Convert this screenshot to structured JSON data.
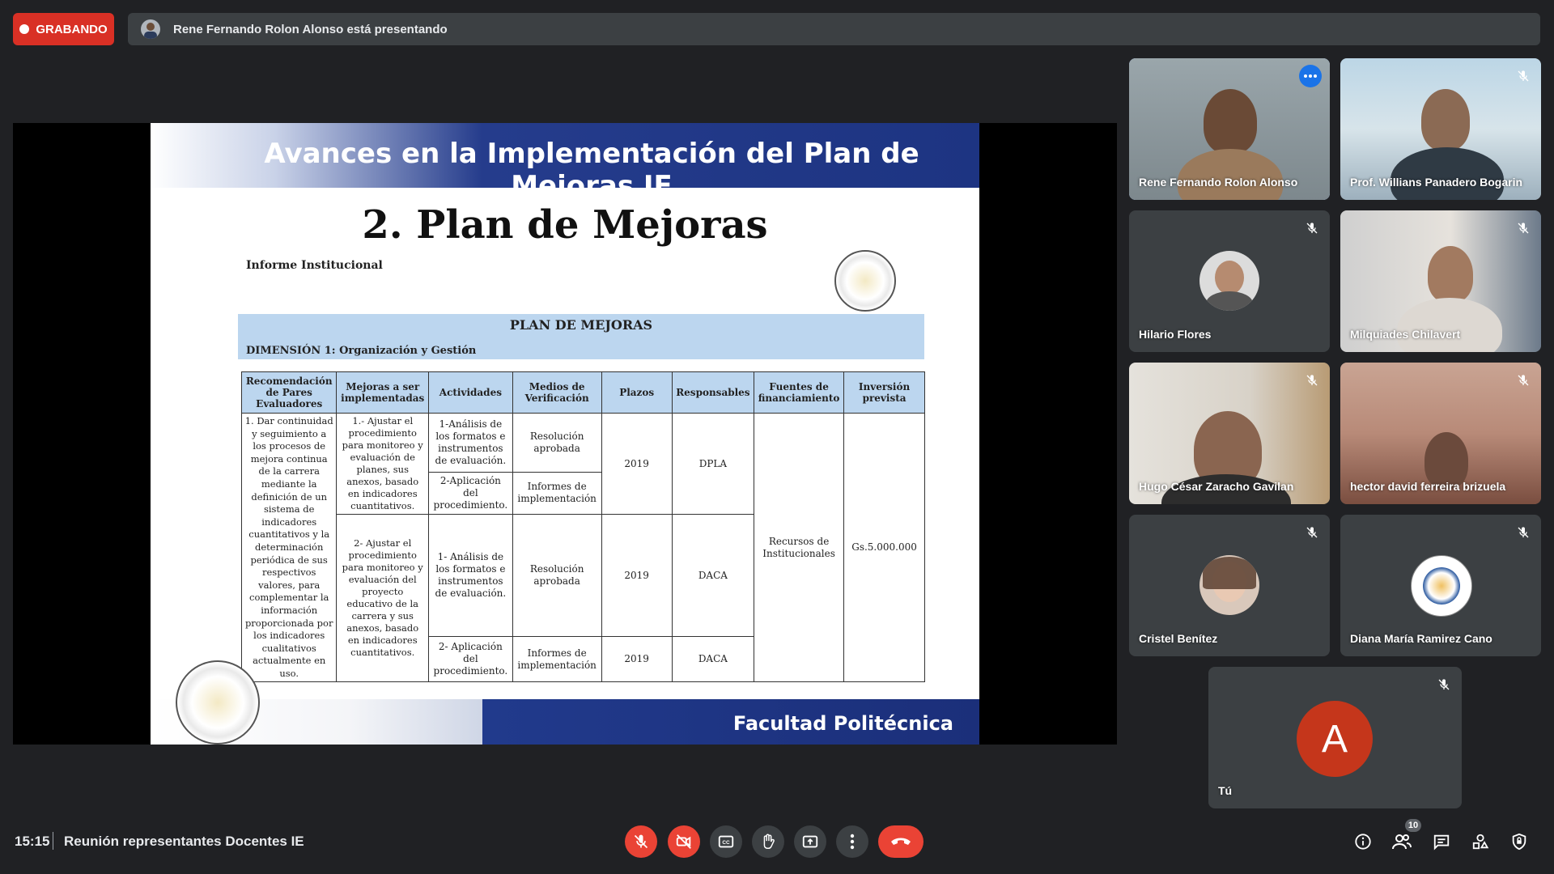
{
  "recording": {
    "label": "GRABANDO"
  },
  "presenting": {
    "text": "Rene Fernando Rolon Alonso está presentando"
  },
  "slide": {
    "header_title": "Avances en la Implementación del Plan de Mejoras IE",
    "subtitle": "2. Plan de Mejoras",
    "report_label": "Informe Institucional",
    "plan_title": "PLAN DE MEJORAS",
    "dimension": "DIMENSIÓN 1: Organización y Gestión",
    "footer": "Facultad Politécnica",
    "table": {
      "headers": [
        "Recomendación de Pares Evaluadores",
        "Mejoras a ser implementadas",
        "Actividades",
        "Medios de Verificación",
        "Plazos",
        "Responsables",
        "Fuentes de financiamiento",
        "Inversión prevista"
      ],
      "recommendation": "1. Dar continuidad y seguimiento a los procesos de mejora continua de la carrera mediante la definición de un sistema de indicadores cuantitativos y la determinación periódica de sus respectivos valores, para complementar la información proporcionada por los indicadores cualitativos actualmente en uso.",
      "improvement_1": "1.- Ajustar el procedimiento para monitoreo y evaluación de planes, sus anexos, basado en indicadores cuantitativos.",
      "improvement_2": "2- Ajustar el procedimiento para monitoreo y evaluación del proyecto educativo de la carrera y sus anexos, basado en indicadores cuantitativos.",
      "act_1": "1-Análisis de los formatos e instrumentos de evaluación.",
      "act_2": "2-Aplicación del procedimiento.",
      "act_3": "1- Análisis de los formatos e instrumentos de evaluación.",
      "act_4": "2- Aplicación del procedimiento.",
      "verif_1": "Resolución aprobada",
      "verif_2": "Informes de implementación",
      "verif_3": "Resolución aprobada",
      "verif_4": "Informes de implementación",
      "plazo_1": "2019",
      "plazo_2": "2019",
      "plazo_3": "2019",
      "resp_1": "DPLA",
      "resp_2": "DACA",
      "resp_3": "DACA",
      "fuente": "Recursos de Institucionales",
      "inversion": "Gs.5.000.000"
    }
  },
  "participants": [
    {
      "name": "Rene Fernando Rolon Alonso",
      "muted": false,
      "active": true
    },
    {
      "name": "Prof. Willians Panadero Bogarin",
      "muted": true
    },
    {
      "name": "Hilario Flores",
      "muted": true
    },
    {
      "name": "Milquiades Chilavert",
      "muted": true
    },
    {
      "name": "Hugo César Zaracho Gavilan",
      "muted": true
    },
    {
      "name": "hector david ferreira brizuela",
      "muted": true
    },
    {
      "name": "Cristel Benítez",
      "muted": true
    },
    {
      "name": "Diana María Ramirez Cano",
      "muted": true
    },
    {
      "name": "Tú",
      "initial": "A",
      "muted": true
    }
  ],
  "bottom": {
    "time": "15:15",
    "meeting_name": "Reunión representantes Docentes IE",
    "participant_count": "10",
    "icons": [
      "mic-off-icon",
      "camera-off-icon",
      "captions-icon",
      "raise-hand-icon",
      "present-icon",
      "more-options-icon",
      "hang-up-icon",
      "info-icon",
      "people-icon",
      "chat-icon",
      "activities-icon",
      "host-controls-icon"
    ]
  },
  "colors": {
    "recording": "#d93025",
    "accent": "#1a73e8",
    "danger": "#ea4335",
    "background": "#202124"
  }
}
